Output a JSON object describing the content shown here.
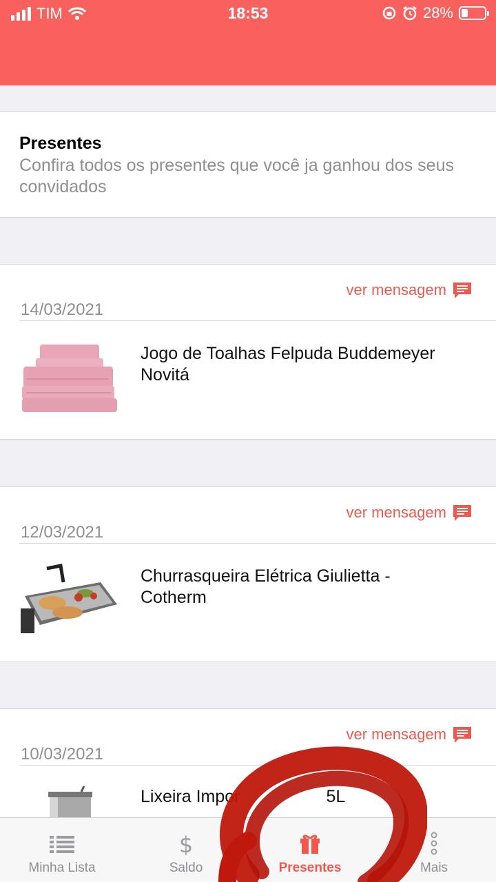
{
  "status_bar": {
    "carrier": "TIM",
    "time": "18:53",
    "battery": "28%",
    "icons": [
      "signal-icon",
      "wifi-icon",
      "lock-rotation-icon",
      "alarm-icon",
      "battery-icon"
    ]
  },
  "header": {
    "title": "Presentes",
    "subtitle": "Confira todos os presentes que você ja ganhou dos seus convidados"
  },
  "gifts": [
    {
      "date": "14/03/2021",
      "message_link": "ver mensagem",
      "name": "Jogo de Toalhas Felpuda Buddemeyer Novitá",
      "image": "towels"
    },
    {
      "date": "12/03/2021",
      "message_link": "ver mensagem",
      "name": "Churrasqueira Elétrica Giulietta - Cotherm",
      "image": "grill"
    },
    {
      "date": "10/03/2021",
      "message_link": "ver mensagem",
      "name": "Lixeira Impor",
      "name_tail": "5L",
      "image": "trash-can"
    }
  ],
  "tabbar": {
    "tabs": [
      {
        "label": "Minha Lista",
        "icon": "list-icon",
        "active": false
      },
      {
        "label": "Saldo",
        "icon": "dollar-icon",
        "active": false
      },
      {
        "label": "Presentes",
        "icon": "gift-icon",
        "active": true
      },
      {
        "label": "Mais",
        "icon": "more-icon",
        "active": false
      }
    ]
  },
  "colors": {
    "accent": "#f8615e",
    "link": "#f0584e",
    "muted_text": "#8e8e93",
    "background": "#efeff4",
    "annotation": "#c0180c"
  }
}
